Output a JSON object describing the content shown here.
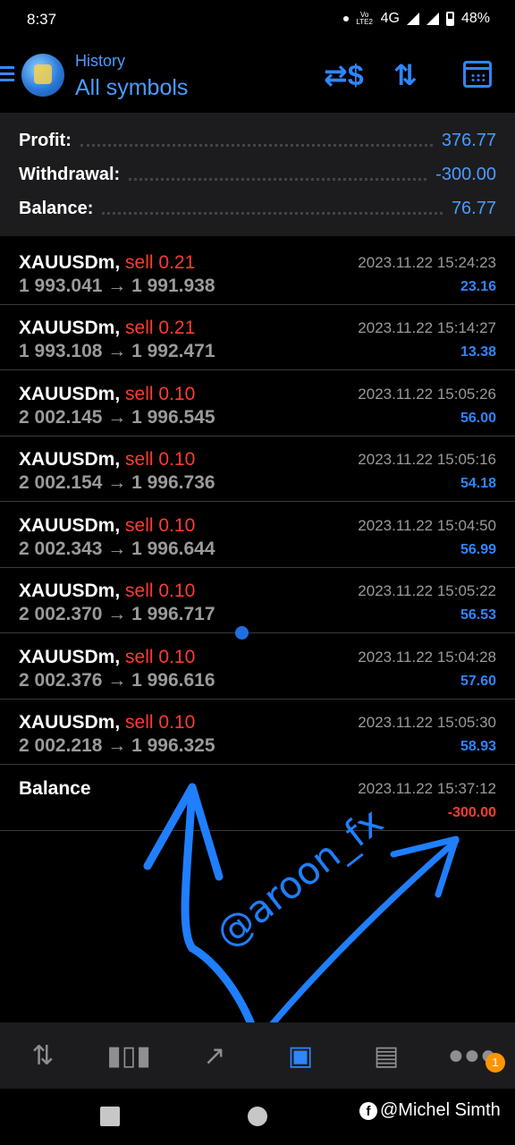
{
  "status_bar": {
    "time": "8:37",
    "network": "4G",
    "battery": "48%",
    "volte": "Vo LTE2"
  },
  "header": {
    "subtitle": "History",
    "title": "All symbols"
  },
  "summary": [
    {
      "label": "Profit:",
      "value": "376.77"
    },
    {
      "label": "Withdrawal:",
      "value": "-300.00"
    },
    {
      "label": "Balance:",
      "value": "76.77"
    }
  ],
  "deals": [
    {
      "symbol": "XAUUSDm,",
      "side": "sell 0.21",
      "prices": "1 993.041 → 1 991.938",
      "time": "2023.11.22 15:24:23",
      "profit": "23.16"
    },
    {
      "symbol": "XAUUSDm,",
      "side": "sell 0.21",
      "prices": "1 993.108 → 1 992.471",
      "time": "2023.11.22 15:14:27",
      "profit": "13.38"
    },
    {
      "symbol": "XAUUSDm,",
      "side": "sell 0.10",
      "prices": "2 002.145 → 1 996.545",
      "time": "2023.11.22 15:05:26",
      "profit": "56.00"
    },
    {
      "symbol": "XAUUSDm,",
      "side": "sell 0.10",
      "prices": "2 002.154 → 1 996.736",
      "time": "2023.11.22 15:05:16",
      "profit": "54.18"
    },
    {
      "symbol": "XAUUSDm,",
      "side": "sell 0.10",
      "prices": "2 002.343 → 1 996.644",
      "time": "2023.11.22 15:04:50",
      "profit": "56.99"
    },
    {
      "symbol": "XAUUSDm,",
      "side": "sell 0.10",
      "prices": "2 002.370 → 1 996.717",
      "time": "2023.11.22 15:05:22",
      "profit": "56.53"
    },
    {
      "symbol": "XAUUSDm,",
      "side": "sell 0.10",
      "prices": "2 002.376 → 1 996.616",
      "time": "2023.11.22 15:04:28",
      "profit": "57.60"
    },
    {
      "symbol": "XAUUSDm,",
      "side": "sell 0.10",
      "prices": "2 002.218 → 1 996.325",
      "time": "2023.11.22 15:05:30",
      "profit": "58.93"
    }
  ],
  "balance_entry": {
    "label": "Balance",
    "time": "2023.11.22 15:37:12",
    "amount": "-300.00"
  },
  "bottom_nav": {
    "items": [
      {
        "icon": "quotes-icon"
      },
      {
        "icon": "chart-icon"
      },
      {
        "icon": "trade-icon"
      },
      {
        "icon": "history-icon",
        "active": true
      },
      {
        "icon": "news-icon"
      },
      {
        "icon": "chat-icon",
        "badge": "1"
      }
    ]
  },
  "watermark": {
    "text": "@aroon_fx"
  },
  "credit": {
    "fb": "f",
    "text": "@Michel Simth"
  },
  "colors": {
    "accent": "#2f86ff",
    "sell": "#ff3b30",
    "badge": "#ff9500"
  }
}
